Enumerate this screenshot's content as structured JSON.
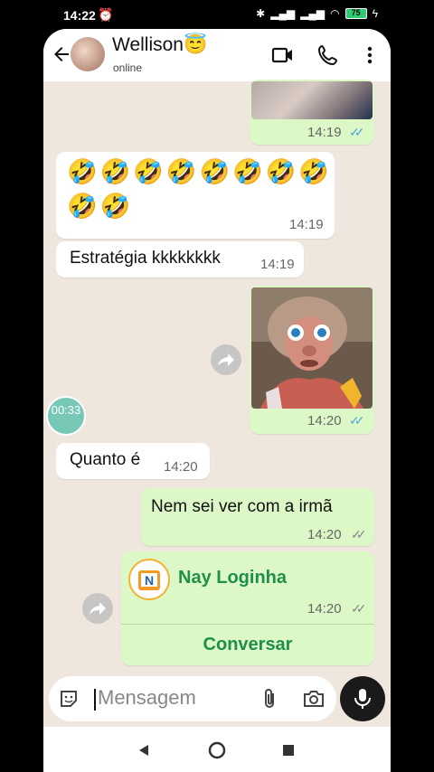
{
  "status_bar": {
    "time": "14:22",
    "battery": "75"
  },
  "header": {
    "contact_name": "Wellison😇",
    "status": "online"
  },
  "messages": [
    {
      "type": "image",
      "time": "14:19"
    },
    {
      "type": "emoji",
      "line1": "🤣🤣🤣🤣🤣🤣🤣🤣",
      "line2": "🤣🤣",
      "time": "14:19"
    },
    {
      "type": "text",
      "text": "Estratégia kkkkkkkk",
      "time": "14:19"
    },
    {
      "type": "image",
      "time": "14:20"
    },
    {
      "type": "text",
      "text": "Quanto é",
      "time": "14:20"
    },
    {
      "type": "text",
      "text": "Nem sei ver com a irmã",
      "time": "14:20"
    },
    {
      "type": "contact",
      "name": "Nay Loginha",
      "time": "14:20",
      "action": "Conversar"
    }
  ],
  "floating_timer": "00:33",
  "input": {
    "placeholder": "Mensagem"
  },
  "colors": {
    "outgoing": "#dcf8c6",
    "incoming": "#ffffff",
    "accent": "#1f8f4b",
    "read_tick": "#4fa6e6"
  }
}
